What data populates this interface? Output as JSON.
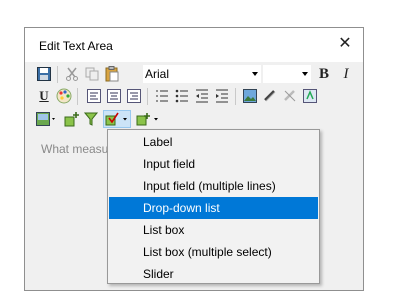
{
  "window": {
    "title": "Edit Text Area",
    "close_label": "✕"
  },
  "toolbar": {
    "font_family": "Arial",
    "font_size": "",
    "bold_label": "B",
    "italic_label": "I",
    "underline_label": "U"
  },
  "editor": {
    "placeholder": "What measu"
  },
  "insert_menu": {
    "items": [
      {
        "label": "Label"
      },
      {
        "label": "Input field"
      },
      {
        "label": "Input field (multiple lines)"
      },
      {
        "label": "Drop-down list"
      },
      {
        "label": "List box"
      },
      {
        "label": "List box (multiple select)"
      },
      {
        "label": "Slider"
      }
    ],
    "selected_index": 3
  },
  "colors": {
    "accent": "#0078d7",
    "menu_bg": "#f2f2f2",
    "dialog_bg": "#f0f0f0"
  }
}
